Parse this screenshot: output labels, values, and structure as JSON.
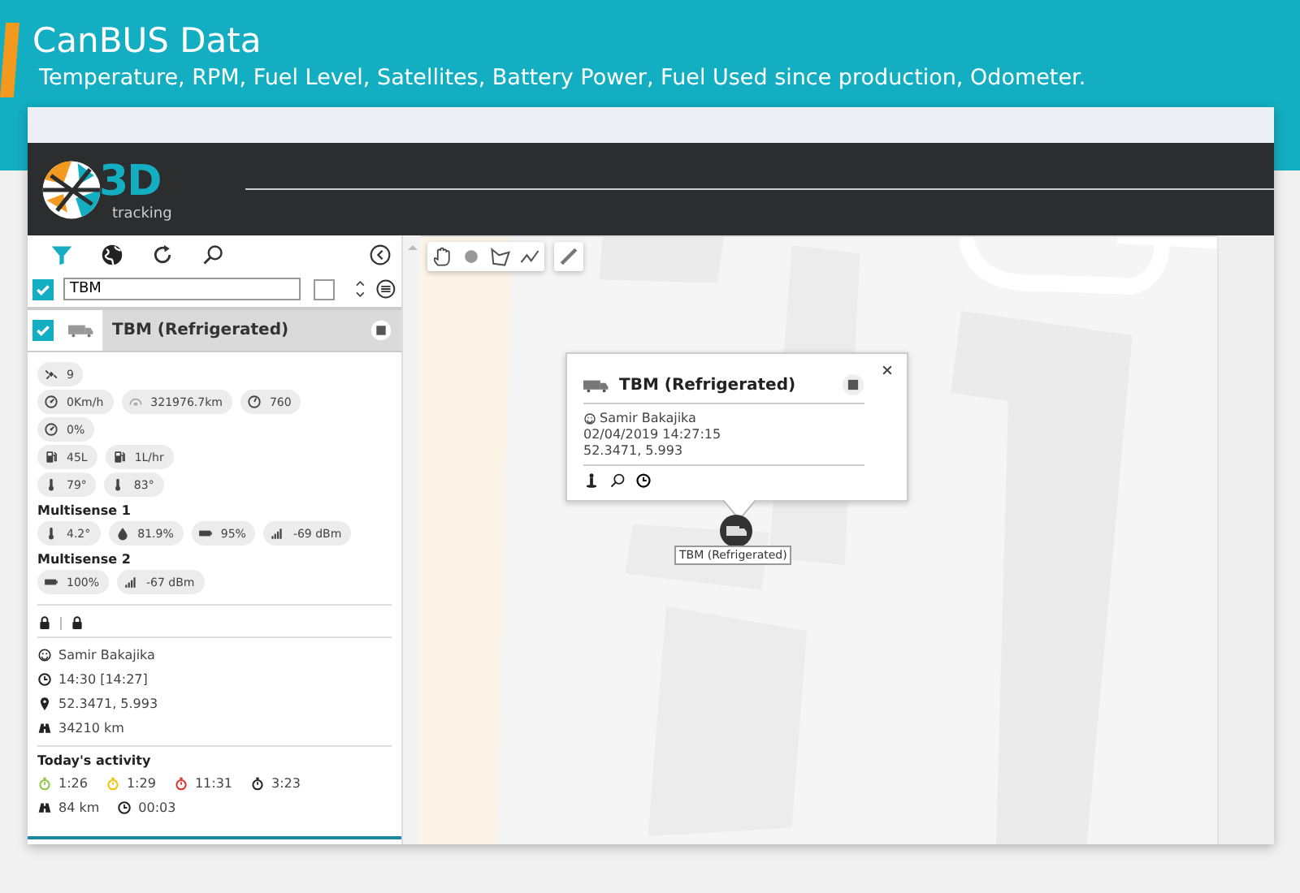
{
  "banner": {
    "title": "CanBUS Data",
    "subtitle": "Temperature, RPM, Fuel Level, Satellites, Battery Power, Fuel Used since production, Odometer."
  },
  "logo": {
    "mark": "3D",
    "word": "tracking"
  },
  "sidebar": {
    "filter": {
      "all_checked": true,
      "value": "TBM",
      "option_checked": false
    },
    "vehicle": {
      "name": "TBM (Refrigerated)",
      "checked": true
    },
    "sensor_rows": [
      [
        {
          "kind": "satellites",
          "text": "9"
        }
      ],
      [
        {
          "kind": "speed",
          "text": "0Km/h"
        },
        {
          "kind": "odometer",
          "text": "321976.7km"
        },
        {
          "kind": "rpm",
          "text": "760"
        }
      ],
      [
        {
          "kind": "speed",
          "text": "0%"
        }
      ],
      [
        {
          "kind": "fuel",
          "text": "45L"
        },
        {
          "kind": "fuel",
          "text": "1L/hr"
        }
      ],
      [
        {
          "kind": "temperature",
          "text": "79°"
        },
        {
          "kind": "temperature",
          "text": "83°"
        }
      ]
    ],
    "groups": [
      {
        "title": "Multisense 1",
        "chips": [
          {
            "kind": "temperature",
            "text": "4.2°"
          },
          {
            "kind": "humidity",
            "text": "81.9%"
          },
          {
            "kind": "battery",
            "text": "95%"
          },
          {
            "kind": "signal",
            "text": "-69 dBm"
          }
        ]
      },
      {
        "title": "Multisense 2",
        "chips": [
          {
            "kind": "battery",
            "text": "100%"
          },
          {
            "kind": "signal",
            "text": "-67 dBm"
          }
        ]
      }
    ],
    "details": [
      {
        "kind": "driver",
        "text": "Samir Bakajika"
      },
      {
        "kind": "time",
        "text": "14:30 [14:27]"
      },
      {
        "kind": "location",
        "text": "52.3471, 5.993"
      },
      {
        "kind": "mileage",
        "text": "34210 km"
      }
    ],
    "activity": {
      "title": "Today's activity",
      "timers": [
        {
          "text": "1:26",
          "color": "#8dc63f"
        },
        {
          "text": "1:29",
          "color": "#f2c200"
        },
        {
          "text": "11:31",
          "color": "#e0302a"
        },
        {
          "text": "3:23",
          "color": "#222222"
        }
      ],
      "summary": [
        {
          "kind": "mileage",
          "text": "84 km"
        },
        {
          "kind": "time",
          "text": "00:03"
        }
      ]
    }
  },
  "map": {
    "popup": {
      "title": "TBM (Refrigerated)",
      "driver": "Samir Bakajika",
      "timestamp": "02/04/2019 14:27:15",
      "coordinates": "52.3471, 5.993"
    },
    "marker_label": "TBM (Refrigerated)"
  }
}
